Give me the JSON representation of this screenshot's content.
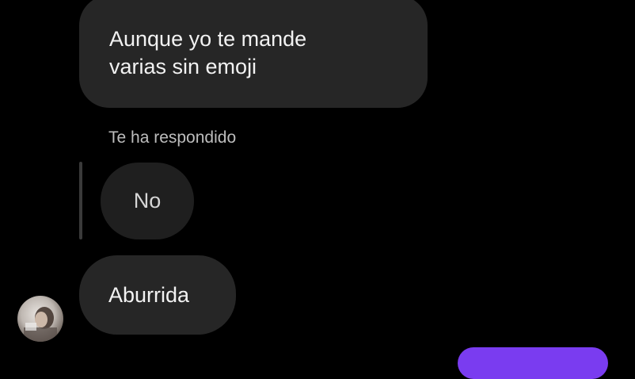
{
  "messages": {
    "received_1": {
      "lines": [
        "Aunque yo te mande",
        "varias sin emoji"
      ]
    },
    "reply_label": "Te ha respondido",
    "quoted_text": "No",
    "received_2": "Aburrida"
  },
  "colors": {
    "background": "#000000",
    "received_bubble": "#262626",
    "quoted_bubble": "#1f1f1f",
    "outgoing_bubble": "#7a3cf0"
  },
  "icons": {
    "avatar": "contact-avatar"
  }
}
